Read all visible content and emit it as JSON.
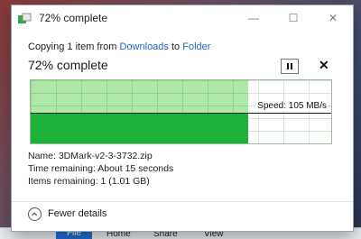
{
  "window": {
    "title": "72% complete",
    "status_prefix": "Copying 1 item from",
    "source": "Downloads",
    "joiner": "to",
    "destination": "Folder",
    "percent_text": "72% complete",
    "progress_fraction": 0.72,
    "speed_text": "Speed: 105 MB/s",
    "name_line": "Name: 3DMark-v2-3-3732.zip",
    "time_line": "Time remaining: About 15 seconds",
    "items_line": "Items remaining: 1 (1.01 GB)",
    "fewer_details": "Fewer details",
    "minimize_glyph": "—",
    "maximize_glyph": "☐",
    "close_glyph": "✕",
    "cancel_glyph": "✕"
  },
  "taskbar": {
    "file": "File",
    "home": "Home",
    "share": "Share",
    "view": "View"
  },
  "colors": {
    "graph_light": "#aee8a6",
    "graph_dark": "#1db33a",
    "link": "#1a66c7"
  }
}
